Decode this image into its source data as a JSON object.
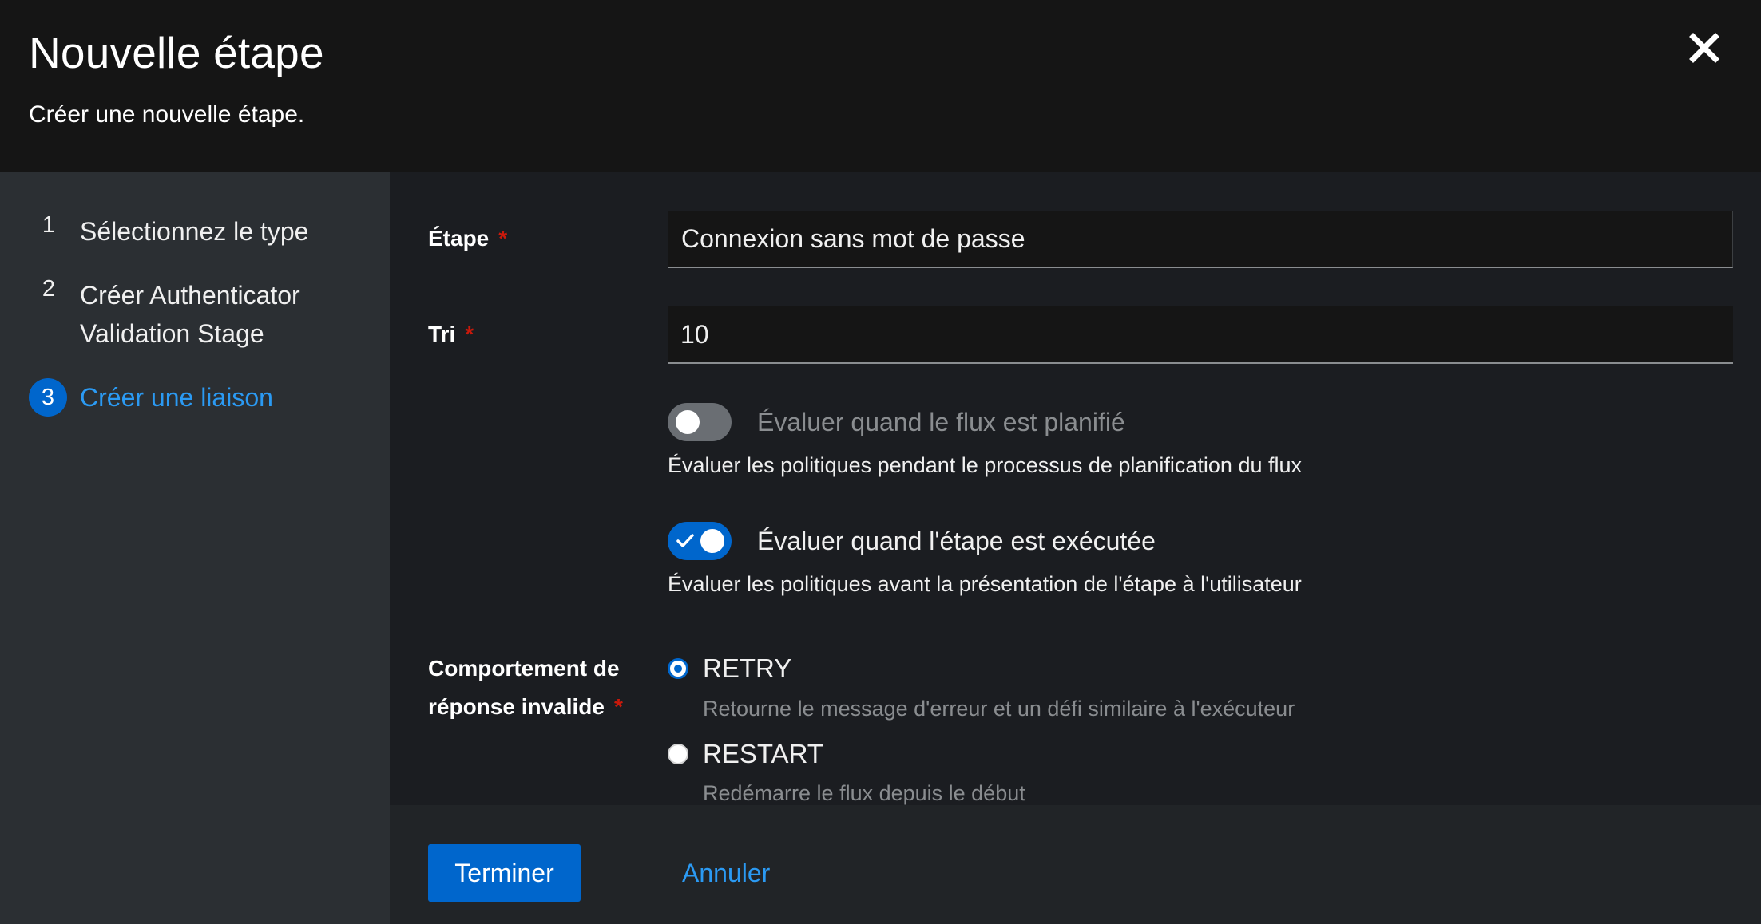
{
  "header": {
    "title": "Nouvelle étape",
    "subtitle": "Créer une nouvelle étape."
  },
  "close_icon": "close-icon",
  "wizard_steps": [
    {
      "number": "1",
      "label": "Sélectionnez le type",
      "current": false
    },
    {
      "number": "2",
      "label": "Créer Authenticator Validation Stage",
      "current": false
    },
    {
      "number": "3",
      "label": "Créer une liaison",
      "current": true
    }
  ],
  "form": {
    "stage": {
      "label": "Étape",
      "required_mark": "*",
      "value": "Connexion sans mot de passe"
    },
    "order": {
      "label": "Tri",
      "required_mark": "*",
      "value": "10"
    },
    "evaluate_on_plan": {
      "label": "Évaluer quand le flux est planifié",
      "help": "Évaluer les politiques pendant le processus de planification du flux",
      "checked": false
    },
    "re_evaluate": {
      "label": "Évaluer quand l'étape est exécutée",
      "help": "Évaluer les politiques avant la présentation de l'étape à l'utilisateur",
      "checked": true
    },
    "invalid_response": {
      "label_line1": "Comportement de",
      "label_line2": "réponse invalide",
      "required_mark": "*",
      "options": [
        {
          "value": "RETRY",
          "description": "Retourne le message d'erreur et un défi similaire à l'exécuteur",
          "selected": true
        },
        {
          "value": "RESTART",
          "description": "Redémarre le flux depuis le début",
          "selected": false
        }
      ]
    }
  },
  "footer": {
    "finish_label": "Terminer",
    "cancel_label": "Annuler"
  },
  "colors": {
    "accent": "#0066cc",
    "link": "#2b9af3",
    "required": "#c9190b"
  }
}
